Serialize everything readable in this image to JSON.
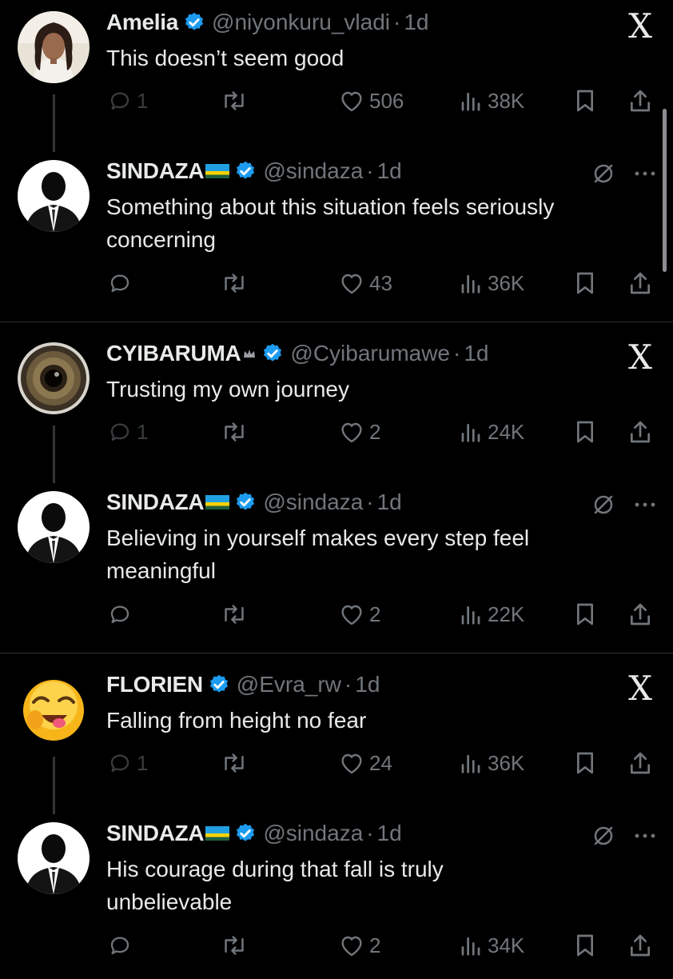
{
  "tweets": [
    {
      "name": "Amelia",
      "handle": "@niyonkuru_vladi",
      "time": "1d",
      "text": [
        "This doesn’t seem good"
      ],
      "reply": "1",
      "likes": "506",
      "views": "38K",
      "corner_icon": "x-logo-icon",
      "flag": false,
      "crown": false,
      "avatar": "woman-photo"
    },
    {
      "name": "SINDAZA",
      "handle": "@sindaza",
      "time": "1d",
      "text": [
        "Something about this situation feels seriously",
        "concerning"
      ],
      "reply": "",
      "likes": "43",
      "views": "36K",
      "corner_icon": "grok-slash-icon",
      "flag": true,
      "crown": false,
      "avatar": "suit-silhouette"
    },
    {
      "name": "CYIBARUMA",
      "handle": "@Cyibarumawe",
      "time": "1d",
      "text": [
        "Trusting my own journey"
      ],
      "reply": "1",
      "likes": "2",
      "views": "24K",
      "corner_icon": "x-logo-icon",
      "flag": false,
      "crown": true,
      "avatar": "eye-closeup"
    },
    {
      "name": "SINDAZA",
      "handle": "@sindaza",
      "time": "1d",
      "text": [
        "Believing in yourself makes every step feel",
        "meaningful"
      ],
      "reply": "",
      "likes": "2",
      "views": "22K",
      "corner_icon": "grok-slash-icon",
      "flag": true,
      "crown": false,
      "avatar": "suit-silhouette"
    },
    {
      "name": "FLORIEN",
      "handle": "@Evra_rw",
      "time": "1d",
      "text": [
        "Falling from height no fear"
      ],
      "reply": "1",
      "likes": "24",
      "views": "36K",
      "corner_icon": "x-logo-icon",
      "flag": false,
      "crown": false,
      "avatar": "laughing-emoji"
    },
    {
      "name": "SINDAZA",
      "handle": "@sindaza",
      "time": "1d",
      "text": [
        "His courage during that fall is truly",
        "unbelievable"
      ],
      "reply": "",
      "likes": "2",
      "views": "34K",
      "corner_icon": "grok-slash-icon",
      "flag": true,
      "crown": false,
      "avatar": "suit-silhouette"
    }
  ],
  "dot_separator": "·",
  "x_logo": "X",
  "colors": {
    "background": "#000000",
    "text": "#e7e9ea",
    "muted": "#71767b",
    "verified": "#1d9bf0",
    "separator": "#2f3336"
  }
}
